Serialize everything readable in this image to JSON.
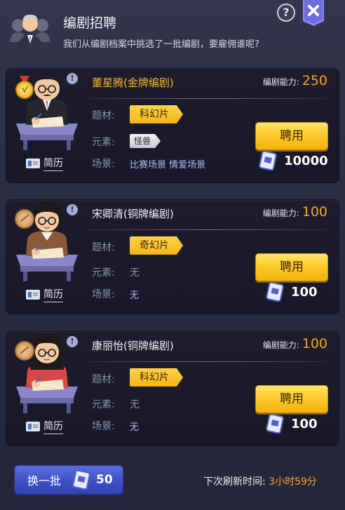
{
  "header": {
    "title": "编剧招聘",
    "subtitle": "我们从编剧档案中挑选了一批编剧，要雇佣谁呢?",
    "help_label": "?",
    "close_icon": "close-icon"
  },
  "colors": {
    "gold": "#f5b623",
    "accent_orange": "#f5a623",
    "scene_purple": "#b8b4f2",
    "button_yellow": "#ffcb2a",
    "button_blue": "#4052c8"
  },
  "candidates": [
    {
      "name": "董星腾(金牌编剧)",
      "tier": "gold",
      "ability_label": "编剧能力:",
      "ability_value": "250",
      "genre_label": "题材:",
      "genre": "科幻片",
      "element_label": "元素:",
      "element": "怪兽",
      "scene_label": "场景:",
      "scene": "比赛场景 情爱场景",
      "hire_label": "聘用",
      "cost": "10000",
      "resume_label": "简历",
      "info_label": "!"
    },
    {
      "name": "宋卿清(铜牌编剧)",
      "tier": "bronze",
      "ability_label": "编剧能力:",
      "ability_value": "100",
      "genre_label": "题材:",
      "genre": "奇幻片",
      "element_label": "元素:",
      "element": "无",
      "scene_label": "场景:",
      "scene": "无",
      "hire_label": "聘用",
      "cost": "100",
      "resume_label": "简历",
      "info_label": "!"
    },
    {
      "name": "康丽怡(铜牌编剧)",
      "tier": "bronze",
      "ability_label": "编剧能力:",
      "ability_value": "100",
      "genre_label": "题材:",
      "genre": "科幻片",
      "element_label": "元素:",
      "element": "无",
      "scene_label": "场景:",
      "scene": "无",
      "hire_label": "聘用",
      "cost": "100",
      "resume_label": "简历",
      "info_label": "!"
    }
  ],
  "footer": {
    "refresh_label": "换一批",
    "refresh_cost": "50",
    "next_refresh_label": "下次刷新时间:",
    "next_refresh_time": "3小时59分"
  }
}
